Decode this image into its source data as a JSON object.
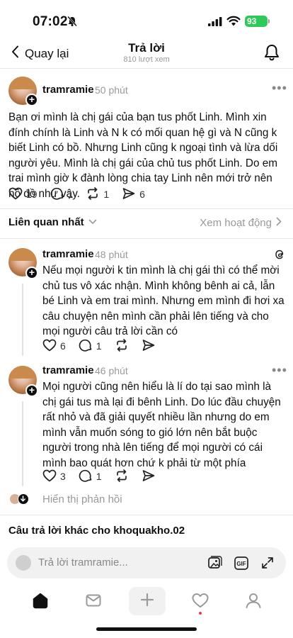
{
  "status_bar": {
    "time": "07:02",
    "battery": "93"
  },
  "header": {
    "back_label": "Quay lại",
    "title": "Trả lời",
    "subtitle": "810 lượt xem"
  },
  "main_post": {
    "username": "tramramie",
    "time": "50 phút",
    "text": "Bạn ơi mình là chị gái của bạn tus phốt Linh. Mình xin đính chính là Linh và N k có mối quan hệ gì và N cũng k biết Linh có bồ. Nhưng Linh cũng k ngoại tình và lừa dối người yêu. Mình là chị gái của chủ tus phốt Linh. Do em trai mình giờ k đành lòng chia tay Linh nên mới trở nên hồ đồ như vậy.",
    "likes": "19",
    "comments": "1",
    "reposts": "1",
    "shares": "6"
  },
  "sort": {
    "label": "Liên quan nhất",
    "activity_label": "Xem hoạt động"
  },
  "replies": [
    {
      "username": "tramramie",
      "time": "48 phút",
      "text": "Nếu mọi người k tin mình là chị gái thì có thể mời chủ tus vô xác nhận. Mình không bênh ai cả, lẫn bé Linh và em trai mình. Nhưng em mình đi hơi xa câu chuyện nên mình cần phải lên tiếng và cho mọi người câu trả lời cần có",
      "likes": "6",
      "comments": "1"
    },
    {
      "username": "tramramie",
      "time": "46 phút",
      "text": "Mọi người cũng nên hiểu là lí do tại sao mình là chị gái tus mà lại đi bênh Linh. Do lúc đầu chuyện rất nhỏ và đã giải quyết nhiều lần nhưng do em mình vẫn muốn sóng to gió lớn nên bắt buộc người trong nhà lên tiếng để mọi người có cái mình bao quát hơn chứ k phải từ một phía",
      "likes": "3",
      "comments": "1"
    }
  ],
  "show_replies_label": "Hiển thị phản hồi",
  "other_replies_label": "Câu trả lời khác cho khoquakho.02",
  "composer": {
    "placeholder": "Trả lời tramramie...",
    "gif_label": "GIF"
  },
  "colors": {
    "text": "#101010",
    "muted": "#999999",
    "battery": "#30c85a",
    "notif_dot": "#ff3040"
  },
  "icons": [
    "bell-off-icon",
    "signal-icon",
    "wifi-icon",
    "back-chevron-icon",
    "bell-icon",
    "heart-icon",
    "comment-icon",
    "repost-icon",
    "send-icon",
    "threads-logo-icon",
    "image-icon",
    "gif-icon",
    "expand-icon",
    "home-icon",
    "inbox-icon",
    "plus-icon",
    "profile-icon"
  ]
}
